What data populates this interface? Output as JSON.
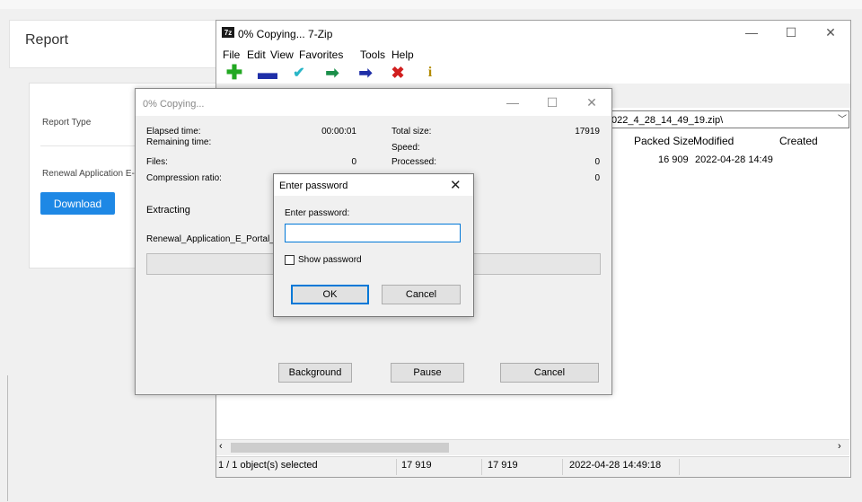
{
  "web": {
    "report_title": "Report",
    "report_type_label": "Report Type",
    "renewal_label": "Renewal Application E-",
    "download_label": "Download"
  },
  "zip": {
    "title": "0% Copying... 7-Zip",
    "logo": "7z",
    "menu": [
      "File",
      "Edit",
      "View",
      "Favorites",
      "Tools",
      "Help"
    ],
    "path": "022_4_28_14_49_19.zip\\",
    "columns": {
      "packed_size": "Packed Size",
      "modified": "Modified",
      "created": "Created"
    },
    "row": {
      "packed_size": "16 909",
      "modified": "2022-04-28 14:49"
    },
    "status": {
      "selected": "1 / 1 object(s) selected",
      "size": "17 919",
      "packed": "17 919",
      "date": "2022-04-28 14:49:18"
    },
    "controls": {
      "minimize": "—",
      "maximize": "☐",
      "close": "✕"
    }
  },
  "copy": {
    "title": "0% Copying...",
    "elapsed_label": "Elapsed time:",
    "elapsed_value": "00:00:01",
    "remaining_label": "Remaining time:",
    "files_label": "Files:",
    "files_value": "0",
    "ratio_label": "Compression ratio:",
    "total_label": "Total size:",
    "total_value": "17919",
    "speed_label": "Speed:",
    "processed_label": "Processed:",
    "processed_value": "0",
    "fourth_value": "0",
    "action": "Extracting",
    "filename": "Renewal_Application_E_Portal_",
    "progress": 0,
    "background_btn": "Background",
    "pause_btn": "Pause",
    "cancel_btn": "Cancel"
  },
  "password": {
    "title": "Enter password",
    "prompt": "Enter password:",
    "value": "",
    "show_label": "Show password",
    "show_checked": false,
    "ok": "OK",
    "cancel": "Cancel"
  }
}
